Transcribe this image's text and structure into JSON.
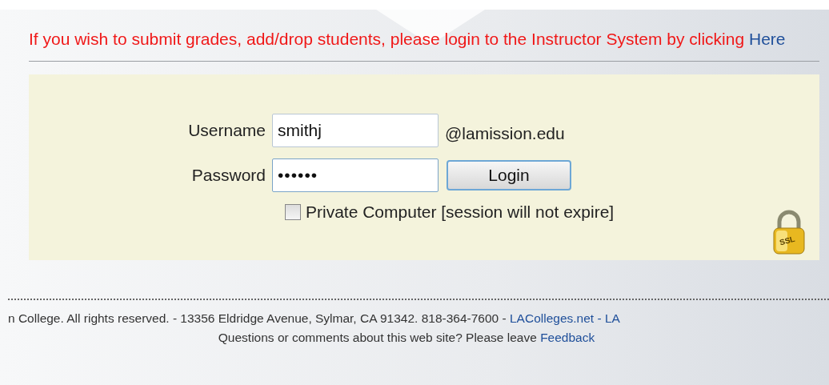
{
  "notice": {
    "text": "If you wish to submit grades, add/drop students, please login to the Instructor System by clicking",
    "link": "Here"
  },
  "login": {
    "username_label": "Username",
    "username_value": "smithj",
    "domain": "@lamission.edu",
    "password_label": "Password",
    "password_value": "••••••",
    "button": "Login",
    "private_label": "Private Computer [session will not expire]",
    "private_checked": false,
    "lock_label": "SSL"
  },
  "footer": {
    "line1_text": "n College. All rights reserved. - 13356 Eldridge Avenue, Sylmar, CA 91342. 818-364-7600 -",
    "line1_link": "LAColleges.net",
    "line1_tail": "- LA",
    "line2_text": "Questions or comments about this web site? Please leave",
    "line2_link": "Feedback"
  }
}
